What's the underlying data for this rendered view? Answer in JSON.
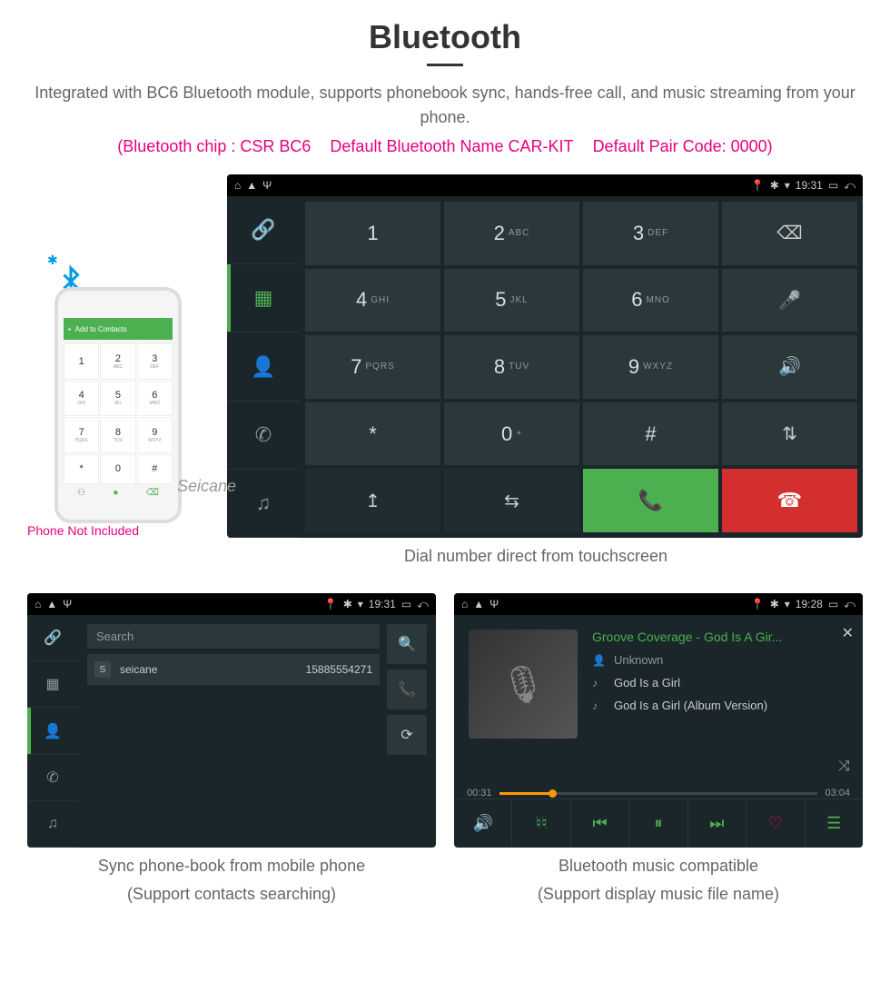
{
  "title": "Bluetooth",
  "subtitle": "Integrated with BC6 Bluetooth module, supports phonebook sync, hands-free call, and music streaming from your phone.",
  "specs": {
    "chip": "(Bluetooth chip : CSR BC6",
    "name": "Default Bluetooth Name CAR-KIT",
    "pair": "Default Pair Code: 0000)"
  },
  "phone_mock": {
    "header": "Add to Contacts",
    "keys": [
      "1",
      "2",
      "3",
      "4",
      "5",
      "6",
      "7",
      "8",
      "9",
      "*",
      "0",
      "#"
    ]
  },
  "seicane_watermark": "Seicane",
  "phone_note": "Phone Not Included",
  "statusbar": {
    "time_main": "19:31",
    "time_pb": "19:31",
    "time_music": "19:28"
  },
  "dialer": {
    "keys": [
      [
        {
          "num": "1",
          "sub": ""
        },
        {
          "num": "2",
          "sub": "ABC"
        },
        {
          "num": "3",
          "sub": "DEF"
        },
        {
          "icon": "⌫"
        }
      ],
      [
        {
          "num": "4",
          "sub": "GHI"
        },
        {
          "num": "5",
          "sub": "JKL"
        },
        {
          "num": "6",
          "sub": "MNO"
        },
        {
          "icon": "🎤̸"
        }
      ],
      [
        {
          "num": "7",
          "sub": "PQRS"
        },
        {
          "num": "8",
          "sub": "TUV"
        },
        {
          "num": "9",
          "sub": "WXYZ"
        },
        {
          "icon": "🔊"
        }
      ],
      [
        {
          "num": "*",
          "sub": ""
        },
        {
          "num": "0",
          "sub": "+"
        },
        {
          "num": "#",
          "sub": ""
        },
        {
          "icon": "⇅"
        }
      ]
    ]
  },
  "caption_main": "Dial number direct from touchscreen",
  "phonebook": {
    "search_placeholder": "Search",
    "contact": {
      "initial": "S",
      "name": "seicane",
      "number": "15885554271"
    }
  },
  "caption_pb_1": "Sync phone-book from mobile phone",
  "caption_pb_2": "(Support contacts searching)",
  "music": {
    "title": "Groove Coverage - God Is A Gir...",
    "artist": "Unknown",
    "track1": "God Is a Girl",
    "track2": "God Is a Girl (Album Version)",
    "elapsed": "00:31",
    "total": "03:04"
  },
  "caption_music_1": "Bluetooth music compatible",
  "caption_music_2": "(Support display music file name)"
}
